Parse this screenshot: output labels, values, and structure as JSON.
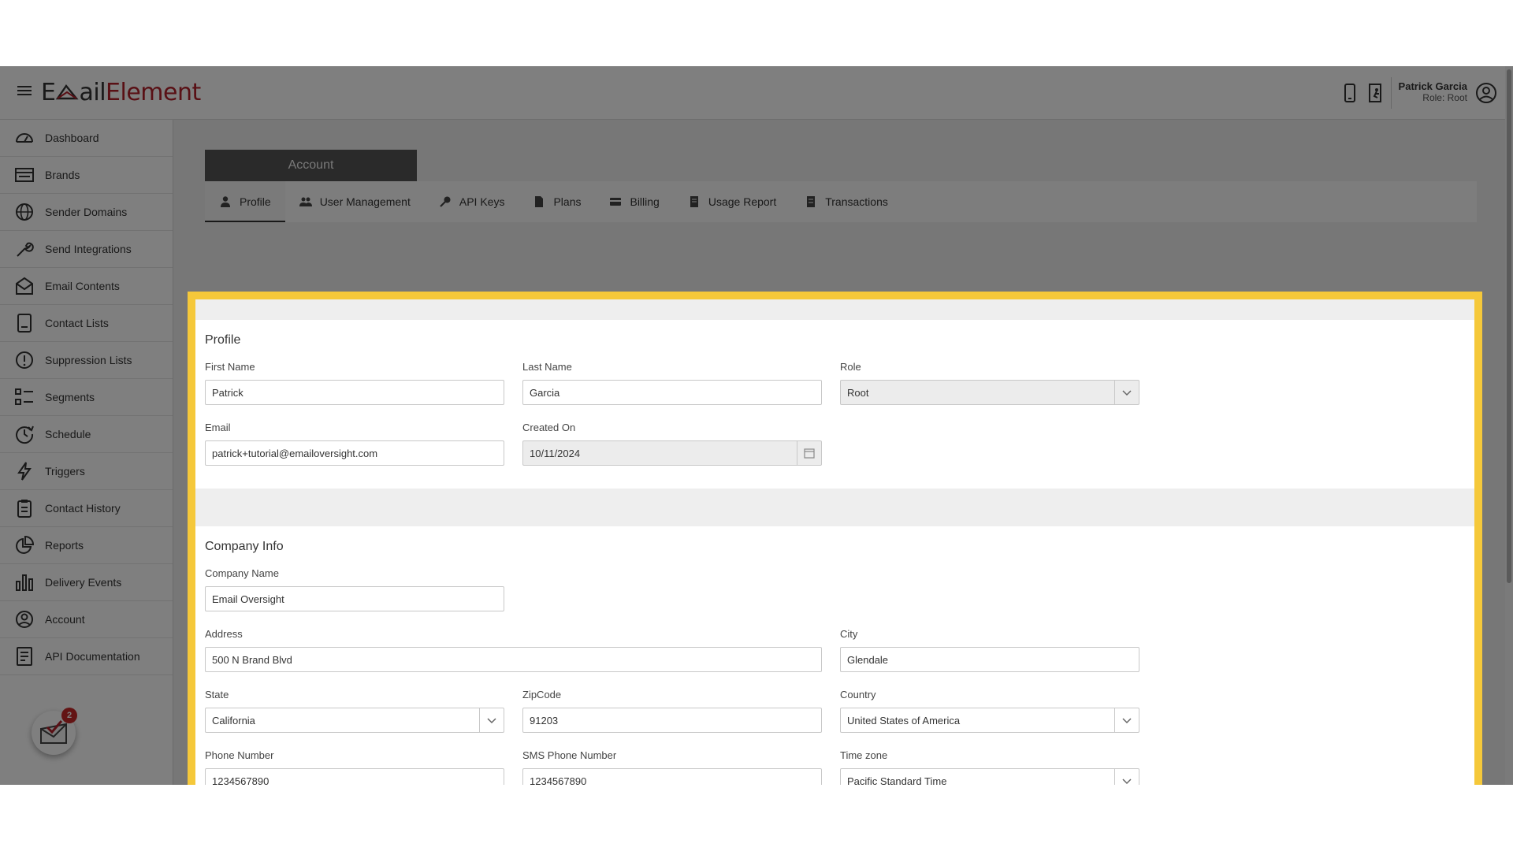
{
  "app": {
    "logo_part1": "E",
    "logo_part2": "ail",
    "logo_part3": "Element"
  },
  "user": {
    "name": "Patrick Garcia",
    "role": "Role: Root"
  },
  "sidebar": {
    "items": [
      {
        "label": "Dashboard",
        "icon": "gauge-icon"
      },
      {
        "label": "Brands",
        "icon": "list-card-icon"
      },
      {
        "label": "Sender Domains",
        "icon": "globe-icon"
      },
      {
        "label": "Send Integrations",
        "icon": "wrench-icon"
      },
      {
        "label": "Email Contents",
        "icon": "envelope-icon"
      },
      {
        "label": "Contact Lists",
        "icon": "contact-book-icon"
      },
      {
        "label": "Suppression Lists",
        "icon": "exclamation-circle-icon"
      },
      {
        "label": "Segments",
        "icon": "segments-list-icon"
      },
      {
        "label": "Schedule",
        "icon": "clock-icon"
      },
      {
        "label": "Triggers",
        "icon": "lightning-icon"
      },
      {
        "label": "Contact History",
        "icon": "clipboard-icon"
      },
      {
        "label": "Reports",
        "icon": "pie-chart-icon"
      },
      {
        "label": "Delivery Events",
        "icon": "bar-chart-icon"
      },
      {
        "label": "Account",
        "icon": "user-circle-icon"
      },
      {
        "label": "API Documentation",
        "icon": "document-icon"
      }
    ],
    "fab_badge": "2"
  },
  "account_header": "Account",
  "tabs": [
    {
      "label": "Profile",
      "icon": "person-icon"
    },
    {
      "label": "User Management",
      "icon": "users-icon"
    },
    {
      "label": "API Keys",
      "icon": "key-icon"
    },
    {
      "label": "Plans",
      "icon": "file-icon"
    },
    {
      "label": "Billing",
      "icon": "credit-card-icon"
    },
    {
      "label": "Usage Report",
      "icon": "report-icon"
    },
    {
      "label": "Transactions",
      "icon": "receipt-icon"
    }
  ],
  "profile": {
    "title": "Profile",
    "first_name_label": "First Name",
    "first_name": "Patrick",
    "last_name_label": "Last Name",
    "last_name": "Garcia",
    "role_label": "Role",
    "role": "Root",
    "email_label": "Email",
    "email": "patrick+tutorial@emailoversight.com",
    "created_label": "Created On",
    "created": "10/11/2024"
  },
  "company": {
    "title": "Company Info",
    "name_label": "Company Name",
    "name": "Email Oversight",
    "address_label": "Address",
    "address": "500 N Brand Blvd",
    "city_label": "City",
    "city": "Glendale",
    "state_label": "State",
    "state": "California",
    "zip_label": "ZipCode",
    "zip": "91203",
    "country_label": "Country",
    "country": "United States of America",
    "phone_label": "Phone Number",
    "phone": "1234567890",
    "sms_label": "SMS Phone Number",
    "sms": "1234567890",
    "tz_label": "Time zone",
    "tz": "Pacific Standard Time"
  },
  "colors": {
    "brand_red": "#b3212b",
    "highlight": "#f5c83a",
    "account_tab": "#555555"
  }
}
